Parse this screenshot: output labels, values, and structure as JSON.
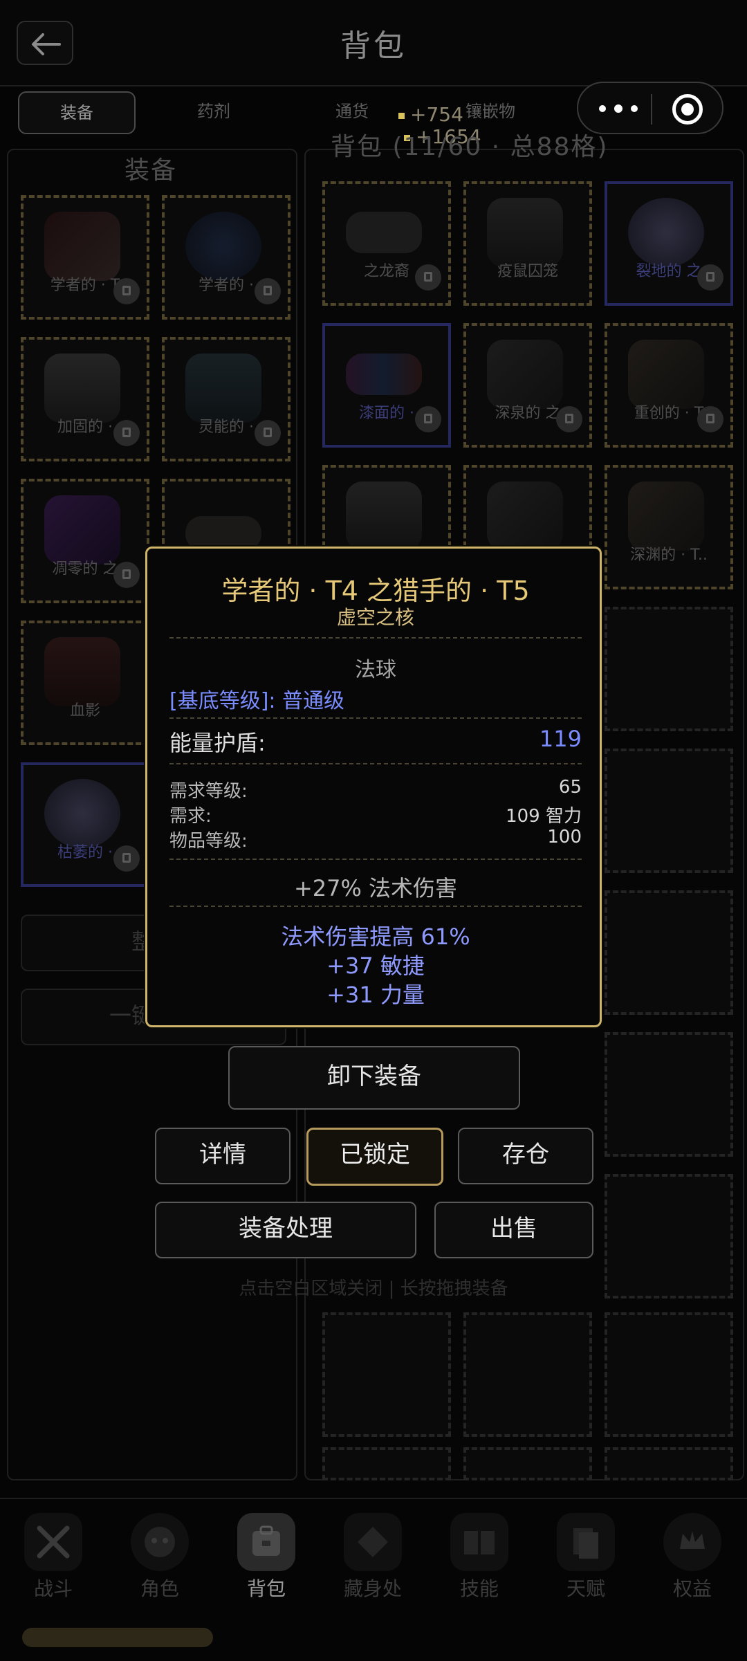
{
  "header": {
    "title": "背包",
    "back_icon": "arrow-left-icon"
  },
  "tabs": [
    {
      "label": "装备",
      "active": true
    },
    {
      "label": "药剂",
      "active": false
    },
    {
      "label": "通货",
      "active": false
    },
    {
      "label": "镶嵌物",
      "active": false
    }
  ],
  "currency": {
    "gold": "+754",
    "shards": "+1654"
  },
  "left_panel": {
    "title": "装备",
    "slots": [
      {
        "label": "学者的 · T",
        "frame": "gold",
        "icon": "staff-icon"
      },
      {
        "label": "学者的 ·",
        "frame": "gold",
        "icon": "orb-icon"
      },
      {
        "label": "加固的 ·",
        "frame": "gold",
        "icon": "helmet-icon"
      },
      {
        "label": "灵能的 ·",
        "frame": "gold",
        "icon": "robe-icon"
      },
      {
        "label": "凋零的 之",
        "frame": "gold",
        "icon": "gloves-icon"
      },
      {
        "label": "",
        "frame": "gold",
        "icon": "belt-icon"
      },
      {
        "label": "血影",
        "frame": "gold",
        "icon": "boots-icon"
      },
      {
        "label": "",
        "frame": "empty",
        "icon": ""
      },
      {
        "label": "枯萎的 ·",
        "frame": "blue",
        "icon": "ring-icon"
      }
    ],
    "sort_button": "整理",
    "one_key_button": "一键出售"
  },
  "right_panel": {
    "title": "背包 (11/60 · 总88格)",
    "slots": [
      {
        "label": "之龙裔",
        "frame": "gold",
        "icon": "belt-icon"
      },
      {
        "label": "疫鼠囚笼",
        "frame": "gold",
        "icon": "armor-icon"
      },
      {
        "label": "裂地的 之",
        "frame": "blue",
        "icon": "ring-icon"
      },
      {
        "label": "漆面的 ·",
        "frame": "blue",
        "icon": "jeweled-belt-icon"
      },
      {
        "label": "深泉的 之",
        "frame": "gold",
        "icon": "quiver-icon"
      },
      {
        "label": "重创的 · T",
        "frame": "gold",
        "icon": "bow-icon"
      },
      {
        "label": "",
        "frame": "gold",
        "icon": "helmet-icon"
      },
      {
        "label": "",
        "frame": "gold",
        "icon": "quiver-icon"
      },
      {
        "label": "深渊的 · T..",
        "frame": "gold",
        "icon": "bow-icon"
      }
    ]
  },
  "item_popup": {
    "name": "学者的 · T4 之猎手的 · T5",
    "base": "虚空之核",
    "type": "法球",
    "tier_line": "[基底等级]: 普通级",
    "energy_shield_label": "能量护盾:",
    "energy_shield_value": "119",
    "requirements": [
      {
        "label": "需求等级:",
        "value": "65"
      },
      {
        "label": "需求:",
        "value": "109 智力"
      },
      {
        "label": "物品等级:",
        "value": "100"
      }
    ],
    "implicit": "+27% 法术伤害",
    "mods": [
      "法术伤害提高 61%",
      "+37 敏捷",
      "+31 力量"
    ]
  },
  "actions": {
    "unequip": "卸下装备",
    "details": "详情",
    "locked": "已锁定",
    "stash": "存仓",
    "process": "装备处理",
    "sell": "出售"
  },
  "hint": "点击空白区域关闭 | 长按拖拽装备",
  "bottom_nav": [
    {
      "label": "战斗",
      "icon": "crossed-swords-icon",
      "active": false
    },
    {
      "label": "角色",
      "icon": "mask-icon",
      "active": false
    },
    {
      "label": "背包",
      "icon": "backpack-icon",
      "active": true
    },
    {
      "label": "藏身处",
      "icon": "hideout-icon",
      "active": false
    },
    {
      "label": "技能",
      "icon": "book-icon",
      "active": false
    },
    {
      "label": "天赋",
      "icon": "cards-icon",
      "active": false
    },
    {
      "label": "权益",
      "icon": "crown-icon",
      "active": false
    }
  ],
  "colors": {
    "accent_gold": "#cfb66a",
    "magic_blue": "#7b8cff",
    "background": "#050505"
  }
}
